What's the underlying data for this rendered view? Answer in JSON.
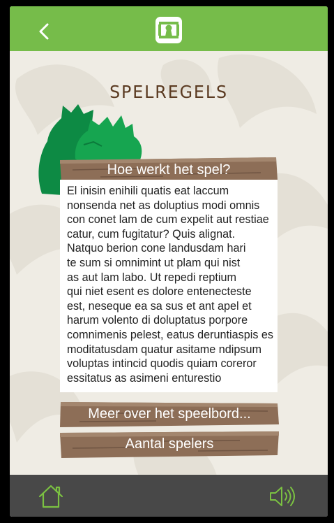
{
  "header": {
    "back_icon": "chevron-left-icon",
    "logo_icon": "keyhole-logo-icon",
    "accent": "#76bc4a"
  },
  "page": {
    "title": "SPELREGELS"
  },
  "sections": {
    "how_it_works": {
      "heading": "Hoe werkt het spel?",
      "body": "El inisin enihili quatis eat laccum\nnonsenda net as doluptius modi omnis\ncon conet lam de cum expelit aut restiae\ncatur, cum fugitatur? Quis alignat.\nNatquo berion cone landusdam hari\nte sum si omnimint ut plam qui nist\nas aut lam labo. Ut repedi reptium\nqui niet esent es dolore entenecteste\nest, neseque ea sa sus et ant apel et\nharum volento di doluptatus porpore\ncomnimenis pelest, eatus deruntiaspis es\nmoditatusdam quatur asitame ndipsum\nvoluptas intincid quodis quiam coreror\nessitatus as asimeni enturestio"
    },
    "more_board": {
      "label": "Meer over het speelbord..."
    },
    "players": {
      "label": "Aantal spelers"
    }
  },
  "footer": {
    "home_icon": "home-icon",
    "sound_icon": "speaker-sound-icon",
    "background": "#484848"
  }
}
